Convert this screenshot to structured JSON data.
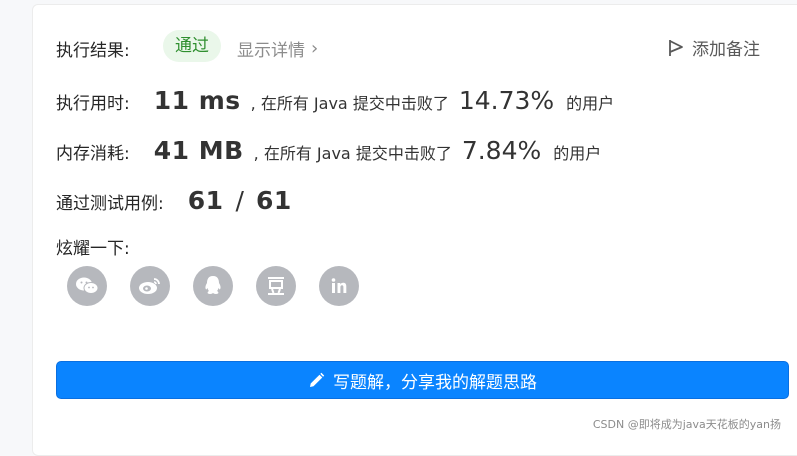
{
  "result": {
    "label": "执行结果:",
    "status": "通过",
    "details_link": "显示详情",
    "add_note": "添加备注"
  },
  "runtime": {
    "label": "执行用时:",
    "value": "11 ms",
    "text_prefix": ", 在所有 Java 提交中击败了",
    "percent": "14.73%",
    "text_suffix": "的用户"
  },
  "memory": {
    "label": "内存消耗:",
    "value": "41 MB",
    "text_prefix": ", 在所有 Java 提交中击败了",
    "percent": "7.84%",
    "text_suffix": "的用户"
  },
  "tests": {
    "label": "通过测试用例:",
    "passed": "61",
    "sep": "/",
    "total": "61"
  },
  "share": {
    "label": "炫耀一下:",
    "icons": [
      "wechat-icon",
      "weibo-icon",
      "qq-icon",
      "douban-icon",
      "linkedin-icon"
    ]
  },
  "solution_button": {
    "label": "写题解，分享我的解题思路"
  },
  "watermark": "CSDN @即将成为java天花板的yan扬",
  "colors": {
    "accent": "#0a84ff",
    "pass_bg": "#eaf7ea",
    "pass_text": "#2f8f2f",
    "icon_gray": "#b6b8bd"
  }
}
